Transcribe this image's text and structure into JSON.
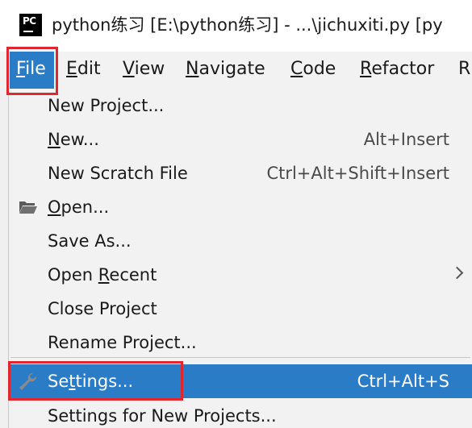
{
  "window": {
    "title": "python练习 [E:\\python练习] - ...\\jichuxiti.py [py",
    "icon": "pycharm-icon",
    "icon_text": "PC"
  },
  "menubar": {
    "items": [
      {
        "mn": "F",
        "rest": "ile"
      },
      {
        "mn": "E",
        "rest": "dit"
      },
      {
        "mn": "V",
        "rest": "iew"
      },
      {
        "mn": "N",
        "rest": "avigate"
      },
      {
        "mn": "C",
        "rest": "ode"
      },
      {
        "mn": "R",
        "rest": "efactor"
      },
      {
        "mn": "",
        "rest": "R"
      }
    ]
  },
  "file_menu": {
    "items": [
      {
        "pre": "New Project...",
        "mn": "",
        "post": "",
        "shortcut": ""
      },
      {
        "pre": "",
        "mn": "N",
        "post": "ew...",
        "shortcut": "Alt+Insert"
      },
      {
        "pre": "New Scratch File",
        "mn": "",
        "post": "",
        "shortcut": "Ctrl+Alt+Shift+Insert"
      },
      {
        "pre": "",
        "mn": "O",
        "post": "pen...",
        "shortcut": "",
        "icon": "folder-open-icon"
      },
      {
        "pre": "Save As...",
        "mn": "",
        "post": "",
        "shortcut": ""
      },
      {
        "pre": "Open ",
        "mn": "R",
        "post": "ecent",
        "shortcut": "",
        "submenu": true
      },
      {
        "pre": "Close Pro",
        "mn": "j",
        "post": "ect",
        "shortcut": ""
      },
      {
        "pre": "Rename Project...",
        "mn": "",
        "post": "",
        "shortcut": ""
      },
      {
        "pre": "Se",
        "mn": "t",
        "post": "tings...",
        "shortcut": "Ctrl+Alt+S",
        "icon": "wrench-icon",
        "selected": true
      },
      {
        "pre": "Settings for New Projects...",
        "mn": "",
        "post": "",
        "shortcut": ""
      }
    ]
  },
  "colors": {
    "selection": "#2a7cc7",
    "highlight_box": "#e0262e",
    "menu_bg": "#f2f2f2"
  }
}
